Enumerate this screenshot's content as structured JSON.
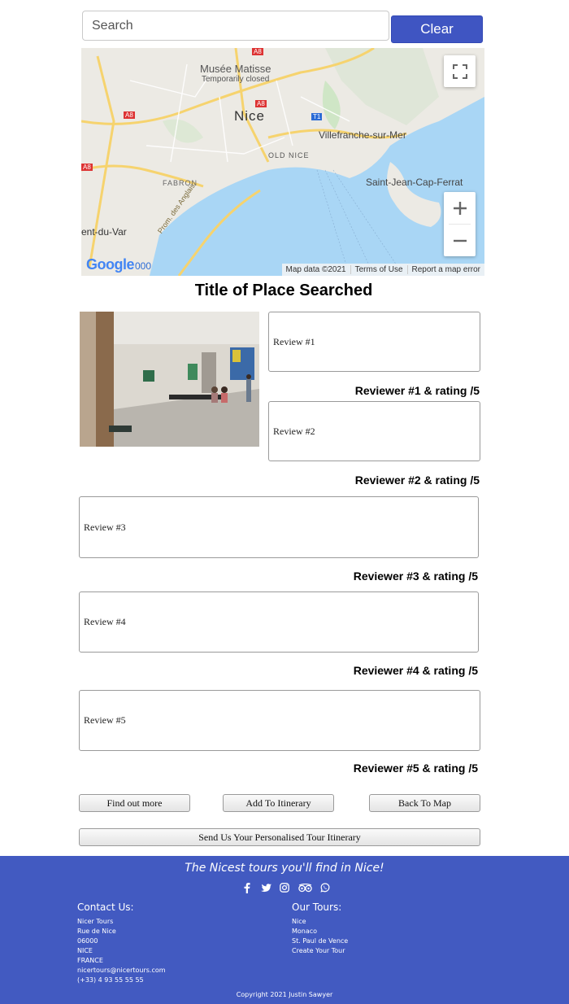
{
  "search": {
    "placeholder": "Search",
    "value": "",
    "clear_label": "Clear"
  },
  "map": {
    "labels": {
      "musee_matisse": "Musée Matisse",
      "temporarily_closed": "Temporarily closed",
      "nice": "Nice",
      "villefranche": "Villefranche-sur-Mer",
      "old_nice": "OLD NICE",
      "fabron": "FABRON",
      "saint_jean": "Saint-Jean-Cap-Ferrat",
      "var": "ent-du-Var",
      "prom": "Prom. des Anglais",
      "a8_1": "A8",
      "a8_2": "A8",
      "a8_3": "A8",
      "a8_4": "A8",
      "t1": "T1",
      "code_000": "000"
    },
    "logo": "Google",
    "footer": {
      "data": "Map data ©2021",
      "terms": "Terms of Use",
      "report": "Report a map error"
    },
    "colors": {
      "water": "#a9d6f5",
      "land": "#eceae4",
      "road": "#f6d36e",
      "park": "#cfe6c6"
    }
  },
  "place": {
    "title": "Title of Place Searched"
  },
  "reviews": [
    {
      "text": "Review #1",
      "reviewer": "Reviewer #1 & rating /5"
    },
    {
      "text": "Review #2",
      "reviewer": "Reviewer #2 & rating /5"
    },
    {
      "text": "Review #3",
      "reviewer": "Reviewer #3 & rating /5"
    },
    {
      "text": "Review #4",
      "reviewer": "Reviewer #4 & rating /5"
    },
    {
      "text": "Review #5",
      "reviewer": "Reviewer #5 & rating /5"
    }
  ],
  "actions": {
    "find_out_more": "Find out more",
    "add_to_itinerary": "Add To Itinerary",
    "back_to_map": "Back To Map",
    "send_itinerary": "Send Us Your Personalised Tour Itinerary"
  },
  "footer": {
    "tagline": "The Nicest tours you'll find in Nice!",
    "social_icons": [
      "facebook-icon",
      "twitter-icon",
      "instagram-icon",
      "tripadvisor-icon",
      "whatsapp-icon"
    ],
    "contact": {
      "heading": "Contact Us:",
      "lines": [
        "Nicer Tours",
        "Rue de Nice",
        "06000",
        "NICE",
        "FRANCE",
        "nicertours@nicertours.com",
        "(+33) 4 93 55 55 55"
      ]
    },
    "tours": {
      "heading": "Our Tours:",
      "lines": [
        "Nice",
        "Monaco",
        "St. Paul de Vence",
        "Create Your Tour"
      ]
    },
    "copyright": "Copyright 2021 Justin Sawyer",
    "background": "#425ac1"
  },
  "accent_color": "#3f55c2"
}
